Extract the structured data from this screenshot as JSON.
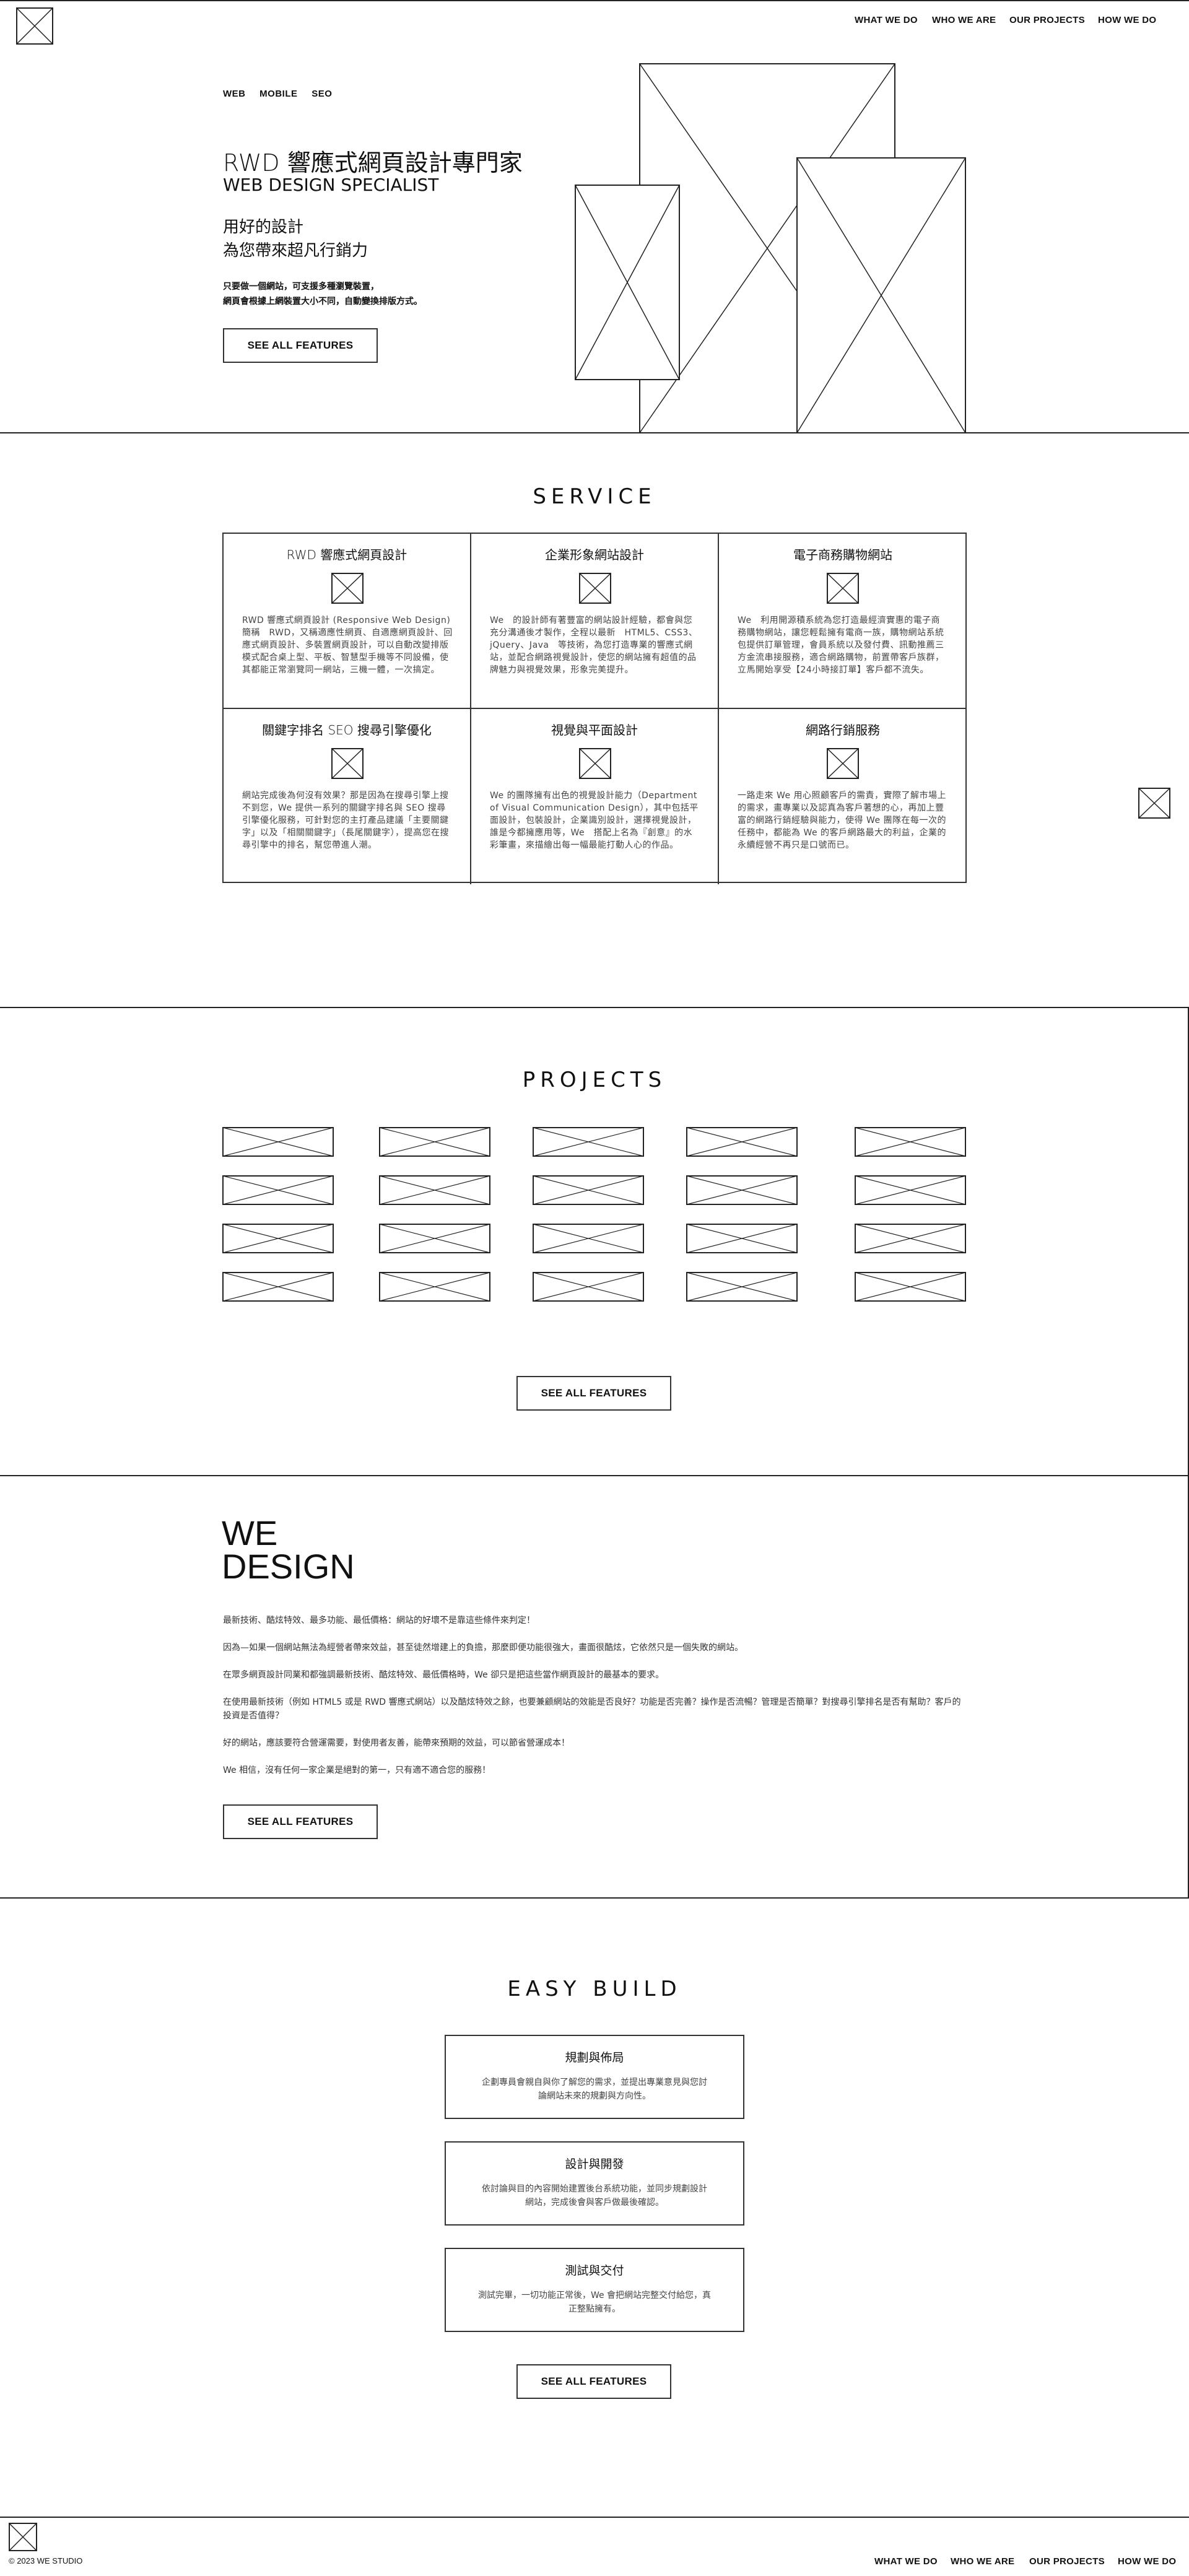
{
  "header": {
    "logo": "logo-placeholder",
    "nav": [
      "WHAT WE DO",
      "WHO WE ARE",
      "OUR PROJECTS",
      "HOW WE DO"
    ]
  },
  "hero": {
    "tags": [
      "WEB",
      "MOBILE",
      "SEO"
    ],
    "title": "RWD 響應式網頁設計專門家",
    "subtitle": "WEB DESIGN SPECIALIST",
    "tagline1": "用好的設計",
    "tagline2": "為您帶來超凡行銷力",
    "desc1": "只要做一個網站，可支援多種瀏覽裝置，",
    "desc2": "網頁會根據上網裝置大小不同，自動變換排版方式。",
    "button": "SEE ALL FEATURES"
  },
  "service": {
    "title": "SERVICE",
    "items": [
      {
        "title": "RWD 響應式網頁設計",
        "text": "RWD 響應式網頁設計 (Responsive Web Design) 簡稱　RWD，又稱適應性網頁、自適應網頁設計、回應式網頁設計、多裝置網頁設計，可以自動改變排版模式配合桌上型、平板、智慧型手機等不同設備，使其都能正常瀏覽同一網站，三機一體，一次搞定。"
      },
      {
        "title": "企業形象網站設計",
        "text": "We　的設計師有著豐富的網站設計經驗，都會與您充分溝通後才製作，全程以最新　HTML5、CSS3、jQuery、Java　等技術，為您打造專業的響應式網站，並配合網路視覺設計，使您的網站擁有超值的品牌魅力與視覺效果，形象完美提升。"
      },
      {
        "title": "電子商務購物網站",
        "text": "We　利用開源積系統為您打造最經濟實惠的電子商務購物網站，讓您輕鬆擁有電商一族，購物網站系統包提供訂單管理，會員系統以及發付費、訊動推薦三方金流串接服務，適合網路購物，前置帶客戶族群，立馬開始享受【24小時接訂單】客戶都不流失。"
      },
      {
        "title": "關鍵字排名 SEO 搜尋引擎優化",
        "text": "網站完成後為何沒有效果？那是因為在搜尋引擎上搜不到您，We 提供一系列的關鍵字排名與 SEO 搜尋引擎優化服務，可針對您的主打產品建議「主要關鍵字」以及「相關關鍵字」（長尾關鍵字），提高您在搜尋引擎中的排名，幫您帶進人潮。"
      },
      {
        "title": "視覺與平面設計",
        "text": "We 的團隊擁有出色的視覺設計能力（Department of Visual Communication Design），其中包括平面設計，包裝設計，企業識別設計，選擇視覺設計，誰是今都擁應用等，We　搭配上名為『創意』的水彩筆畫，來描繪出每一幅最能打動人心的作品。"
      },
      {
        "title": "網路行銷服務",
        "text": "一路走來 We 用心照顧客戶的需責，實際了解市場上的需求，畫專業以及認真為客戶著想的心，再加上豐富的網路行銷經驗與能力，使得 We 團隊在每一次的任務中，都能為 We 的客戶網路最大的利益，企業的永續經營不再只是口號而已。"
      }
    ]
  },
  "projects": {
    "title": "PROJECTS",
    "count": 20,
    "button": "SEE ALL FEATURES"
  },
  "we_design": {
    "line1": "WE",
    "line2": "DESIGN",
    "paragraphs": [
      "最新技術、酷炫特效、最多功能、最低價格：網站的好壞不是靠這些條件來判定！",
      "因為—如果一個網站無法為經營者帶來效益，甚至徒然增建上的負擔，那麼即便功能很強大，畫面很酷炫，它依然只是一個失敗的網站。",
      "在眾多網頁設計同業和都強調最新技術、酷炫特效、最低價格時，We 卻只是把這些當作網頁設計的最基本的要求。",
      "在使用最新技術（例如 HTML5 或是 RWD 響應式網站）以及酷炫特效之餘，也要兼顧網站的效能是否良好？功能是否完善？操作是否流暢？管理是否簡單？對搜尋引擎排名是否有幫助？客戶的投資是否值得？",
      "好的網站，應該要符合營運需要，對使用者友善，能帶來預期的效益，可以節省營運成本！",
      "We 相信，沒有任何一家企業是絕對的第一，只有適不適合您的服務！"
    ],
    "button": "SEE ALL FEATURES"
  },
  "easy_build": {
    "title": "EASY BUILD",
    "steps": [
      {
        "title": "規劃與佈局",
        "line1": "企劃專員會親自與你了解您的需求，並提出專業意見與您討",
        "line2": "論網站未來的規劃與方向性。"
      },
      {
        "title": "設計與開發",
        "line1": "依討論與目的內容開始建置後台系統功能，並同步規劃設計",
        "line2": "網站，完成後會與客戶做最後確認。"
      },
      {
        "title": "測試與交付",
        "line1": "測試完畢，一切功能正常後，We 會把網站完整交付給您，真",
        "line2": "正整點擁有。"
      }
    ],
    "button": "SEE ALL FEATURES"
  },
  "footer": {
    "copyright": "© 2023 WE STUDIO",
    "nav": [
      "WHAT WE DO",
      "WHO WE ARE",
      "OUR PROJECTS",
      "HOW WE DO"
    ]
  }
}
